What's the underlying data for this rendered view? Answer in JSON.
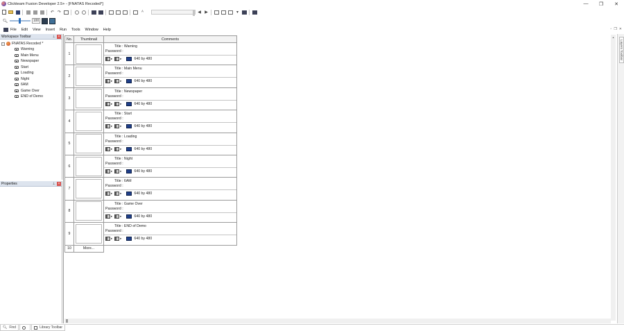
{
  "window": {
    "title": "Clickteam Fusion Developer 2.5+ - [FNATAS Recoded*]",
    "minimize": "—",
    "maximize": "❐",
    "close": "✕"
  },
  "toolbar": {
    "zoom_value": "100"
  },
  "menu": {
    "items": [
      "File",
      "Edit",
      "View",
      "Insert",
      "Run",
      "Tools",
      "Window",
      "Help"
    ]
  },
  "workspace": {
    "header": "Workspace Toolbar",
    "root": "FNATAS Recoded *",
    "frames": [
      "Warning",
      "Main Menu",
      "Newspaper",
      "Start",
      "Loading",
      "Night",
      "6AM",
      "Game Over",
      "END of Demo"
    ]
  },
  "properties": {
    "header": "Properties"
  },
  "frame_table": {
    "headers": {
      "no": "No.",
      "thumbnail": "Thumbnail",
      "comments": "Comments"
    },
    "rows": [
      {
        "no": "1",
        "title": "Title : Warning",
        "password": "Password :",
        "resolution": "640  by  480"
      },
      {
        "no": "2",
        "title": "Title : Main Menu",
        "password": "Password :",
        "resolution": "640  by  480"
      },
      {
        "no": "3",
        "title": "Title : Newspaper",
        "password": "Password :",
        "resolution": "640  by  480"
      },
      {
        "no": "4",
        "title": "Title : Start",
        "password": "Password :",
        "resolution": "640  by  480"
      },
      {
        "no": "5",
        "title": "Title : Loading",
        "password": "Password :",
        "resolution": "640  by  480"
      },
      {
        "no": "6",
        "title": "Title : Night",
        "password": "Password :",
        "resolution": "640  by  480"
      },
      {
        "no": "7",
        "title": "Title : 6AM",
        "password": "Password :",
        "resolution": "640  by  480"
      },
      {
        "no": "8",
        "title": "Title : Game Over",
        "password": "Password :",
        "resolution": "640  by  480"
      },
      {
        "no": "9",
        "title": "Title : END of Demo",
        "password": "Password :",
        "resolution": "640  by  480"
      }
    ],
    "more_no": "10",
    "more_label": "More..."
  },
  "right_strip": {
    "label": "Layers Toolbar"
  },
  "statusbar": {
    "find": "Find",
    "library": "Library Toolbar"
  }
}
